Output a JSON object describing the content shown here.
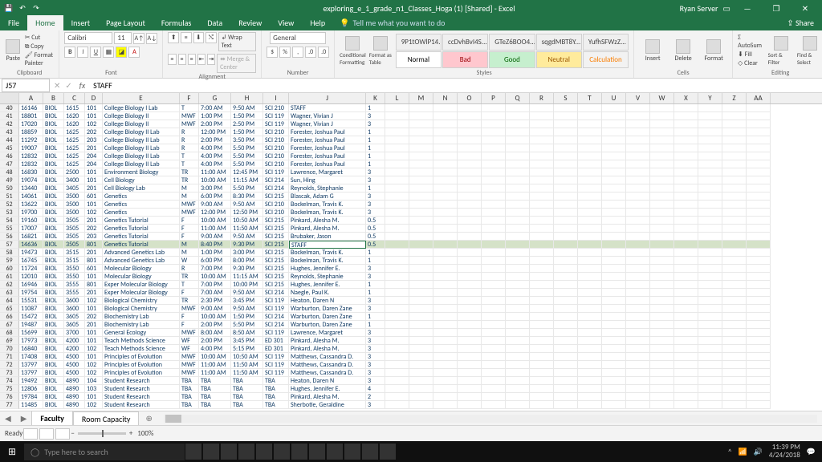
{
  "title": "exploring_e_1_grade_n1_Classes_Hoga (1)  [Shared]  -  Excel",
  "user": "Ryan Server",
  "tabs": [
    "File",
    "Home",
    "Insert",
    "Page Layout",
    "Formulas",
    "Data",
    "Review",
    "View",
    "Help"
  ],
  "tell": "Tell me what you want to do",
  "share": "Share",
  "clipboard": {
    "cut": "Cut",
    "copy": "Copy",
    "painter": "Format Painter",
    "paste": "Paste",
    "group": "Clipboard"
  },
  "font": {
    "name": "Calibri",
    "size": "11",
    "group": "Font"
  },
  "alignment": {
    "wrap": "Wrap Text",
    "merge": "Merge & Center",
    "group": "Alignment"
  },
  "number": {
    "combo": "General",
    "group": "Number"
  },
  "styles": {
    "cond": "Conditional Formatting",
    "fmtTable": "Format as Table",
    "group": "Styles",
    "cells": [
      "9P1tOWlP14...",
      "ccDvhBvI4S...",
      "GTeZ6BOO4...",
      "sqgdMBT8Y...",
      "YufhSFWzZ...",
      "Normal",
      "Bad",
      "Good",
      "Neutral",
      "Calculation"
    ]
  },
  "cells_grp": {
    "insert": "Insert",
    "delete": "Delete",
    "format": "Format",
    "group": "Cells"
  },
  "editing": {
    "sum": "AutoSum",
    "fill": "Fill",
    "clear": "Clear",
    "sort": "Sort & Filter",
    "find": "Find & Select",
    "group": "Editing"
  },
  "namebox": "J57",
  "formula": "STAFF",
  "cols": [
    "A",
    "B",
    "C",
    "D",
    "E",
    "F",
    "G",
    "H",
    "I",
    "J",
    "K",
    "L",
    "M",
    "N",
    "O",
    "P",
    "Q",
    "R",
    "S",
    "T",
    "U",
    "V",
    "W",
    "X",
    "Y",
    "Z",
    "AA"
  ],
  "rows": [
    {
      "n": 40,
      "d": [
        "16146",
        "BIOL",
        "1615",
        "101",
        "College Biology I Lab",
        "T",
        "7:00 AM",
        "9:50 AM",
        "SCI 210",
        "STAFF",
        "1"
      ]
    },
    {
      "n": 41,
      "d": [
        "18801",
        "BIOL",
        "1620",
        "101",
        "College Biology II",
        "MWF",
        "1:00 PM",
        "1:50 PM",
        "SCI 119",
        "Wagner, Vivian J",
        "3"
      ]
    },
    {
      "n": 42,
      "d": [
        "17020",
        "BIOL",
        "1620",
        "102",
        "College Biology II",
        "MWF",
        "2:00 PM",
        "2:50 PM",
        "SCI 119",
        "Wagner, Vivian J",
        "3"
      ]
    },
    {
      "n": 43,
      "d": [
        "18859",
        "BIOL",
        "1625",
        "202",
        "College Biology II Lab",
        "R",
        "12:00 PM",
        "1:50 PM",
        "SCI 210",
        "Forester, Joshua Paul",
        "1"
      ]
    },
    {
      "n": 44,
      "d": [
        "11292",
        "BIOL",
        "1625",
        "203",
        "College Biology II Lab",
        "R",
        "2:00 PM",
        "3:50 PM",
        "SCI 210",
        "Forester, Joshua Paul",
        "1"
      ]
    },
    {
      "n": 45,
      "d": [
        "19007",
        "BIOL",
        "1625",
        "201",
        "College Biology II Lab",
        "R",
        "4:00 PM",
        "5:50 PM",
        "SCI 210",
        "Forester, Joshua Paul",
        "1"
      ]
    },
    {
      "n": 46,
      "d": [
        "12832",
        "BIOL",
        "1625",
        "204",
        "College Biology II Lab",
        "T",
        "4:00 PM",
        "5:50 PM",
        "SCI 210",
        "Forester, Joshua Paul",
        "1"
      ]
    },
    {
      "n": 47,
      "d": [
        "12832",
        "BIOL",
        "1625",
        "204",
        "College Biology II Lab",
        "T",
        "4:00 PM",
        "5:50 PM",
        "SCI 210",
        "Forester, Joshua Paul",
        "1"
      ]
    },
    {
      "n": 48,
      "d": [
        "16830",
        "BIOL",
        "2500",
        "101",
        "Environment Biology",
        "TR",
        "11:00 AM",
        "12:45 PM",
        "SCI 119",
        "Lawrence, Margaret",
        "3"
      ]
    },
    {
      "n": 49,
      "d": [
        "19074",
        "BIOL",
        "3400",
        "101",
        "Cell Biology",
        "TR",
        "10:00 AM",
        "11:15 AM",
        "SCI 214",
        "Sun, Hing",
        "3"
      ]
    },
    {
      "n": 50,
      "d": [
        "13440",
        "BIOL",
        "3405",
        "201",
        "Cell Biology Lab",
        "M",
        "3:00 PM",
        "5:50 PM",
        "SCI 214",
        "Reynolds, Stephanie",
        "1"
      ]
    },
    {
      "n": 51,
      "d": [
        "14061",
        "BIOL",
        "3500",
        "601",
        "Genetics",
        "M",
        "6:00 PM",
        "8:30 PM",
        "SCI 215",
        "Blascak, Adam G",
        "3"
      ]
    },
    {
      "n": 52,
      "d": [
        "13622",
        "BIOL",
        "3500",
        "101",
        "Genetics",
        "MWF",
        "9:00 AM",
        "9:50 AM",
        "SCI 210",
        "Bockelman, Travis K.",
        "3"
      ]
    },
    {
      "n": 53,
      "d": [
        "19700",
        "BIOL",
        "3500",
        "102",
        "Genetics",
        "MWF",
        "12:00 PM",
        "12:50 PM",
        "SCI 210",
        "Bockelman, Travis K.",
        "3"
      ]
    },
    {
      "n": 54,
      "d": [
        "19160",
        "BIOL",
        "3505",
        "201",
        "Genetics Tutorial",
        "F",
        "10:00 AM",
        "10:50 AM",
        "SCI 215",
        "Pinkard, Alesha M.",
        "0.5"
      ]
    },
    {
      "n": 55,
      "d": [
        "17007",
        "BIOL",
        "3505",
        "202",
        "Genetics Tutorial",
        "F",
        "11:00 AM",
        "11:50 AM",
        "SCI 215",
        "Pinkard, Alesha M.",
        "0.5"
      ]
    },
    {
      "n": 56,
      "d": [
        "16821",
        "BIOL",
        "3505",
        "203",
        "Genetics Tutorial",
        "F",
        "9:00 AM",
        "9:50 AM",
        "SCI 215",
        "Brubaker, Jason",
        "0.5"
      ]
    },
    {
      "n": 57,
      "d": [
        "14636",
        "BIOL",
        "3505",
        "801",
        "Genetics Tutorial",
        "M",
        "8:40 PM",
        "9:30 PM",
        "SCI 215",
        "STAFF",
        "0.5"
      ],
      "sel": true
    },
    {
      "n": 58,
      "d": [
        "19473",
        "BIOL",
        "3515",
        "201",
        "Advanced Genetics Lab",
        "M",
        "1:00 PM",
        "3:00 PM",
        "SCI 215",
        "Bockelman, Travis K.",
        "1"
      ]
    },
    {
      "n": 59,
      "d": [
        "16745",
        "BIOL",
        "3515",
        "801",
        "Advanced Genetics Lab",
        "W",
        "6:00 PM",
        "8:00 PM",
        "SCI 215",
        "Bockelman, Travis K.",
        "1"
      ]
    },
    {
      "n": 60,
      "d": [
        "11724",
        "BIOL",
        "3550",
        "601",
        "Molecular Biology",
        "R",
        "7:00 PM",
        "9:30 PM",
        "SCI 215",
        "Hughes, Jennifer E.",
        "3"
      ]
    },
    {
      "n": 61,
      "d": [
        "12010",
        "BIOL",
        "3550",
        "101",
        "Molecular Biology",
        "TR",
        "10:00 AM",
        "11:15 AM",
        "SCI 215",
        "Reynolds, Stephanie",
        "3"
      ]
    },
    {
      "n": 62,
      "d": [
        "16946",
        "BIOL",
        "3555",
        "801",
        "Exper Molecular Biology",
        "T",
        "7:00 PM",
        "10:00 PM",
        "SCI 215",
        "Hughes, Jennifer E.",
        "1"
      ]
    },
    {
      "n": 63,
      "d": [
        "19754",
        "BIOL",
        "3555",
        "201",
        "Exper Molecular Biology",
        "F",
        "7:00 AM",
        "9:50 AM",
        "SCI 214",
        "Naegle, Paul K.",
        "1"
      ]
    },
    {
      "n": 64,
      "d": [
        "15531",
        "BIOL",
        "3600",
        "102",
        "Biological Chemistry",
        "TR",
        "2:30 PM",
        "3:45 PM",
        "SCI 119",
        "Heaton, Daren N",
        "3"
      ]
    },
    {
      "n": 65,
      "d": [
        "11087",
        "BIOL",
        "3600",
        "101",
        "Biological Chemistry",
        "MWF",
        "9:00 AM",
        "9:50 AM",
        "SCI 119",
        "Warburton, Daren Zane",
        "3"
      ]
    },
    {
      "n": 66,
      "d": [
        "15472",
        "BIOL",
        "3605",
        "202",
        "Biochemistry Lab",
        "F",
        "10:00 AM",
        "1:50 PM",
        "SCI 214",
        "Warburton, Daren Zane",
        "1"
      ]
    },
    {
      "n": 67,
      "d": [
        "19487",
        "BIOL",
        "3605",
        "201",
        "Biochemistry Lab",
        "F",
        "2:00 PM",
        "5:50 PM",
        "SCI 214",
        "Warburton, Daren Zane",
        "1"
      ]
    },
    {
      "n": 68,
      "d": [
        "15699",
        "BIOL",
        "3700",
        "101",
        "General Ecology",
        "MWF",
        "8:00 AM",
        "8:50 AM",
        "SCI 119",
        "Lawrence, Margaret",
        "3"
      ]
    },
    {
      "n": 69,
      "d": [
        "17973",
        "BIOL",
        "4200",
        "101",
        "Teach Methods Science",
        "WF",
        "2:00 PM",
        "3:45 PM",
        "ED 301",
        "Pinkard, Alesha M.",
        "3"
      ]
    },
    {
      "n": 70,
      "d": [
        "16840",
        "BIOL",
        "4200",
        "102",
        "Teach Methods Science",
        "WF",
        "4:00 PM",
        "5:15 PM",
        "ED 301",
        "Pinkard, Alesha M.",
        "3"
      ]
    },
    {
      "n": 71,
      "d": [
        "17408",
        "BIOL",
        "4500",
        "101",
        "Principles of Evolution",
        "MWF",
        "10:00 AM",
        "10:50 AM",
        "SCI 119",
        "Matthews, Cassandra D.",
        "3"
      ]
    },
    {
      "n": 72,
      "d": [
        "13797",
        "BIOL",
        "4500",
        "102",
        "Principles of Evolution",
        "MWF",
        "11:00 AM",
        "11:50 AM",
        "SCI 119",
        "Matthews, Cassandra D.",
        "3"
      ]
    },
    {
      "n": 73,
      "d": [
        "13797",
        "BIOL",
        "4500",
        "102",
        "Principles of Evolution",
        "MWF",
        "11:00 AM",
        "11:50 AM",
        "SCI 119",
        "Matthews, Cassandra D.",
        "3"
      ]
    },
    {
      "n": 74,
      "d": [
        "19492",
        "BIOL",
        "4890",
        "104",
        "Student Research",
        "TBA",
        "TBA",
        "TBA",
        "TBA",
        "Heaton, Daren N",
        "3"
      ]
    },
    {
      "n": 75,
      "d": [
        "12806",
        "BIOL",
        "4890",
        "103",
        "Student Research",
        "TBA",
        "TBA",
        "TBA",
        "TBA",
        "Hughes, Jennifer E.",
        "4"
      ]
    },
    {
      "n": 76,
      "d": [
        "19784",
        "BIOL",
        "4890",
        "101",
        "Student Research",
        "TBA",
        "TBA",
        "TBA",
        "TBA",
        "Pinkard, Alesha M.",
        "2"
      ]
    },
    {
      "n": 77,
      "d": [
        "11485",
        "BIOL",
        "4890",
        "102",
        "Student Research",
        "TBA",
        "TBA",
        "TBA",
        "TBA",
        "Sherbotie, Geraldine",
        "3"
      ]
    }
  ],
  "sheets": [
    "Faculty",
    "Room Capacity"
  ],
  "status": "Ready",
  "zoom": "100%",
  "search": "Type here to search",
  "clock": {
    "time": "11:39 PM",
    "date": "4/24/2018"
  }
}
